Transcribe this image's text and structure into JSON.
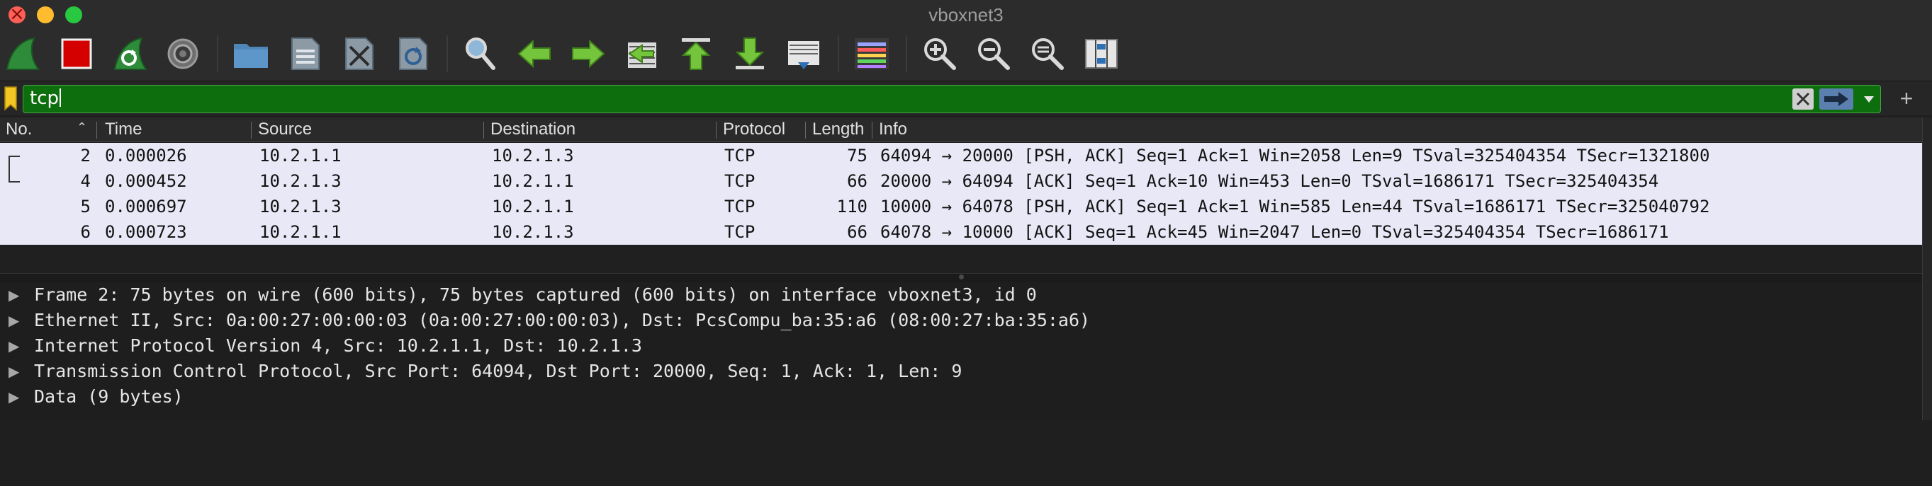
{
  "window": {
    "title": "vboxnet3"
  },
  "toolbar": {
    "tools": [
      "start-capture-icon",
      "stop-capture-icon",
      "restart-capture-icon",
      "capture-options-icon",
      "open-file-icon",
      "save-file-icon",
      "close-file-icon",
      "reload-file-icon",
      "find-packet-icon",
      "go-back-icon",
      "go-forward-icon",
      "go-to-packet-icon",
      "first-packet-icon",
      "last-packet-icon",
      "auto-scroll-icon",
      "colorize-icon",
      "zoom-in-icon",
      "zoom-out-icon",
      "zoom-reset-icon",
      "resize-columns-icon"
    ]
  },
  "filter": {
    "value": "tcp",
    "add_label": "+"
  },
  "colors": {
    "filter_valid": "#0c6e0c",
    "list_background": "#e8e8f7",
    "details_background": "#1e1e1e"
  },
  "packet_list": {
    "columns": [
      "No.",
      "Time",
      "Source",
      "Destination",
      "Protocol",
      "Length",
      "Info"
    ],
    "rows": [
      {
        "no": "2",
        "time": "0.000026",
        "source": "10.2.1.1",
        "destination": "10.2.1.3",
        "protocol": "TCP",
        "length": "75",
        "info": "64094 → 20000 [PSH, ACK] Seq=1 Ack=1 Win=2058 Len=9 TSval=325404354 TSecr=1321800"
      },
      {
        "no": "4",
        "time": "0.000452",
        "source": "10.2.1.3",
        "destination": "10.2.1.1",
        "protocol": "TCP",
        "length": "66",
        "info": "20000 → 64094 [ACK] Seq=1 Ack=10 Win=453 Len=0 TSval=1686171 TSecr=325404354"
      },
      {
        "no": "5",
        "time": "0.000697",
        "source": "10.2.1.3",
        "destination": "10.2.1.1",
        "protocol": "TCP",
        "length": "110",
        "info": "10000 → 64078 [PSH, ACK] Seq=1 Ack=1 Win=585 Len=44 TSval=1686171 TSecr=325040792"
      },
      {
        "no": "6",
        "time": "0.000723",
        "source": "10.2.1.1",
        "destination": "10.2.1.3",
        "protocol": "TCP",
        "length": "66",
        "info": "64078 → 10000 [ACK] Seq=1 Ack=45 Win=2047 Len=0 TSval=325404354 TSecr=1686171"
      }
    ]
  },
  "packet_details": [
    "Frame 2: 75 bytes on wire (600 bits), 75 bytes captured (600 bits) on interface vboxnet3, id 0",
    "Ethernet II, Src: 0a:00:27:00:00:03 (0a:00:27:00:00:03), Dst: PcsCompu_ba:35:a6 (08:00:27:ba:35:a6)",
    "Internet Protocol Version 4, Src: 10.2.1.1, Dst: 10.2.1.3",
    "Transmission Control Protocol, Src Port: 64094, Dst Port: 20000, Seq: 1, Ack: 1, Len: 9",
    "Data (9 bytes)"
  ]
}
